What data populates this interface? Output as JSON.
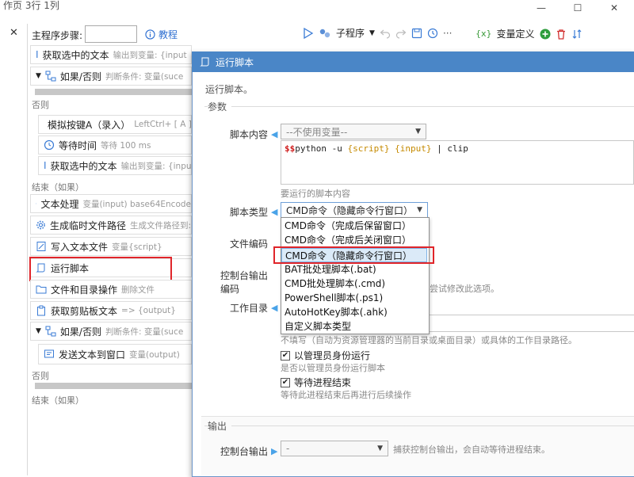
{
  "window": {
    "title": "作页 3行 1列",
    "minimize": "—",
    "maximize": "☐",
    "close": "✕"
  },
  "left": {
    "close": "✕"
  },
  "toolbar": {
    "main_steps_label": "主程序步骤:",
    "tutorial": "教程",
    "subprogram": "子程序",
    "more": "···",
    "var_def_icon_text": "{x}",
    "var_def": "变量定义"
  },
  "flow": {
    "rows": [
      {
        "name": "获取选中的文本",
        "desc": "输出到变量: {input"
      },
      {
        "name": "如果/否则",
        "desc": "判断条件: 变量(suce"
      },
      {
        "name": "模拟按键A（录入）",
        "desc": "LeftCtrl+ [ A ]"
      },
      {
        "name": "等待时间",
        "desc": "等待 100 ms"
      },
      {
        "name": "获取选中的文本",
        "desc": "输出到变量: {inpu"
      },
      {
        "name": "文本处理",
        "desc": "变量(input) base64Encode"
      },
      {
        "name": "生成临时文件路径",
        "desc": "生成文件路径到:"
      },
      {
        "name": "写入文本文件",
        "desc": "变量{script}"
      },
      {
        "name": "运行脚本",
        "desc": ""
      },
      {
        "name": "文件和目录操作",
        "desc": "删除文件"
      },
      {
        "name": "获取剪贴板文本",
        "desc": "=> {output}"
      },
      {
        "name": "如果/否则",
        "desc": "判断条件: 变量(suce"
      },
      {
        "name": "发送文本到窗口",
        "desc": "变量(output)"
      }
    ],
    "else_label": "否则",
    "end_label": "结束（如果）"
  },
  "dialog": {
    "title": "运行脚本",
    "description": "运行脚本。",
    "params_group": "参数",
    "script_content_label": "脚本内容",
    "script_var_placeholder": "--不使用变量--",
    "script_text": {
      "prefix": "$$",
      "cmd": "python -u ",
      "tok1": "{script}",
      "space": " ",
      "tok2": "{input}",
      "tail": " | clip"
    },
    "script_hint": "要运行的脚本内容",
    "script_type_label": "脚本类型",
    "script_type_value": "CMD命令（隐藏命令行窗口）",
    "script_type_options": [
      "CMD命令（完成后保留窗口）",
      "CMD命令（完成后关闭窗口）",
      "CMD命令（隐藏命令行窗口）",
      "BAT批处理脚本(.bat)",
      "CMD批处理脚本(.cmd)",
      "PowerShell脚本(.ps1)",
      "AutoHotKey脚本(.ahk)",
      "自定义脚本类型"
    ],
    "file_encoding_label": "文件编码",
    "console_encoding_label_1": "控制台输出",
    "console_encoding_label_2": "编码",
    "console_encoding_hint": "尝试修改此选项。",
    "workdir_label": "工作目录",
    "workdir_hint": "不填写（自动为资源管理器的当前目录或桌面目录）或具体的工作目录路径。",
    "admin_checkbox": "以管理员身份运行",
    "admin_hint": "是否以管理员身份运行脚本",
    "admin_checked": true,
    "wait_checkbox": "等待进程结束",
    "wait_hint": "等待此进程结束后再进行后续操作",
    "wait_checked": true,
    "output_group": "输出",
    "console_output_label": "控制台输出",
    "console_output_value": "-",
    "console_output_hint": "捕获控制台输出，会自动等待进程结束。"
  },
  "colors": {
    "accent": "#4a86c7",
    "highlight_red": "#e0252a",
    "icon_blue": "#4aa3e8"
  }
}
